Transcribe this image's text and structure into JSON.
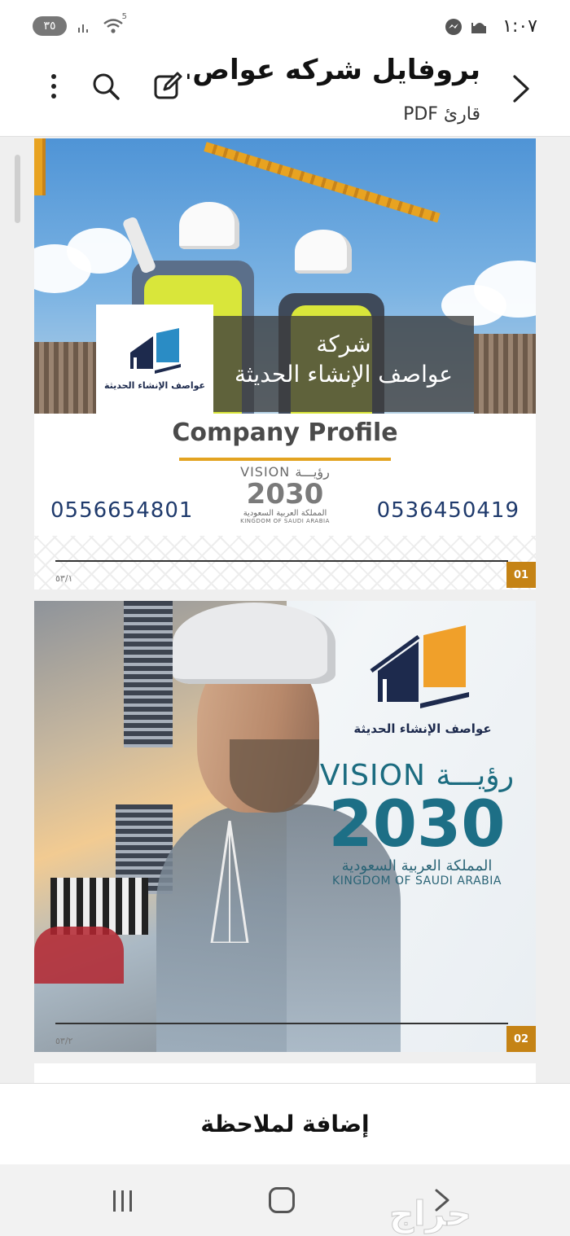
{
  "status_bar": {
    "time": "١:٠٧",
    "battery": "٣٥",
    "wifi_label": "5"
  },
  "app_bar": {
    "title": "بروفايل شركه عواص...",
    "subtitle": "قارئ PDF",
    "icons": [
      "back-arrow-icon",
      "edit-icon",
      "search-icon",
      "more-vert-icon"
    ]
  },
  "page1": {
    "banner_line1": "شركة",
    "banner_line2": "عواصف الإنشاء الحديثة",
    "logo_caption": "عواصف الإنشاء الحديثة",
    "title": "Company Profile",
    "phone_left": "0556654801",
    "phone_right": "0536450419",
    "vision_top": "VISION رؤيـــة",
    "vision_num": "2030",
    "vision_ar": "المملكة العربية السعودية",
    "vision_en": "KINGDOM OF SAUDI ARABIA",
    "page_badge": "01",
    "page_small": "٥٣/١"
  },
  "page2": {
    "logo_caption": "عواصف الإنشاء الحديثة",
    "vision_top": "VISION رؤيـــة",
    "vision_num": "2030",
    "vision_ar": "المملكة العربية السعودية",
    "vision_en": "KINGDOM OF SAUDI ARABIA",
    "page_badge": "02",
    "page_small": "٥٣/٢"
  },
  "bottom": {
    "add_note": "إضافة لملاحظة"
  },
  "watermark": "حراج",
  "colors": {
    "accent_gold": "#e3a321",
    "navy": "#1d2a4d",
    "vision_teal": "#1d6f86"
  }
}
